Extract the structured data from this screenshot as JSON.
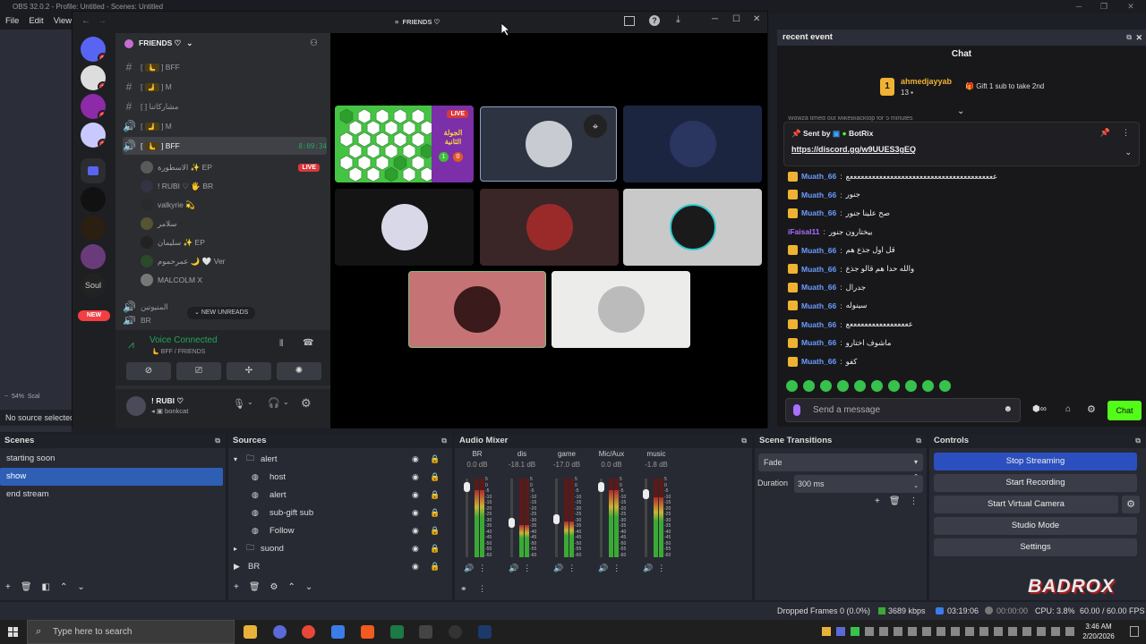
{
  "obs": {
    "title": "OBS 32.0.2 - Profile: Untitled - Scenes: Untitled",
    "menu": [
      "File",
      "Edit",
      "View"
    ],
    "zoom": "54%",
    "scale_label": "Scal",
    "no_source": "No source selected",
    "scenes": {
      "title": "Scenes",
      "items": [
        "starting soon",
        "show",
        "end stream"
      ],
      "selected": "show"
    },
    "sources": {
      "title": "Sources",
      "items": [
        {
          "name": "alert",
          "type": "folder",
          "indent": 0,
          "expanded": true
        },
        {
          "name": "host",
          "type": "browser",
          "indent": 1
        },
        {
          "name": "alert",
          "type": "browser",
          "indent": 1
        },
        {
          "name": "sub-gift sub",
          "type": "browser",
          "indent": 1
        },
        {
          "name": "Follow",
          "type": "browser",
          "indent": 1
        },
        {
          "name": "suond",
          "type": "folder",
          "indent": 0,
          "expanded": false
        },
        {
          "name": "BR",
          "type": "scene",
          "indent": 0,
          "expanded": false
        }
      ]
    },
    "mixer": {
      "title": "Audio Mixer",
      "channels": [
        {
          "name": "BR",
          "db": "0.0 dB",
          "level": 0.95
        },
        {
          "name": "dis",
          "db": "-18.1 dB",
          "level": 0.45
        },
        {
          "name": "game",
          "db": "-17.0 dB",
          "level": 0.5
        },
        {
          "name": "Mic/Aux",
          "db": "0.0 dB",
          "level": 0.95
        },
        {
          "name": "music",
          "db": "-1.8 dB",
          "level": 0.85
        }
      ],
      "scale": [
        "5",
        "0",
        "-5",
        "-10",
        "-15",
        "-20",
        "-25",
        "-30",
        "-35",
        "-40",
        "-45",
        "-50",
        "-55",
        "-60"
      ]
    },
    "transitions": {
      "title": "Scene Transitions",
      "selected": "Fade",
      "duration_label": "Duration",
      "duration": "300 ms"
    },
    "controls": {
      "title": "Controls",
      "buttons": [
        "Stop Streaming",
        "Start Recording",
        "Start Virtual Camera",
        "Studio Mode",
        "Settings"
      ]
    },
    "status": {
      "dropped": "Dropped Frames 0 (0.0%)",
      "kbps": "3689 kbps",
      "live_time": "03:19:06",
      "rec_time": "00:00:00",
      "cpu": "CPU: 3.8%",
      "fps": "60.00 / 60.00 FPS"
    }
  },
  "discord": {
    "title": "FRIENDS ♡",
    "server_name": "FRIENDS ♡",
    "channels": [
      {
        "icon": "#",
        "emoji": "🫷",
        "name": "BFF"
      },
      {
        "icon": "#",
        "emoji": "🫸",
        "name": "M"
      },
      {
        "icon": "#",
        "emoji": "",
        "name": "مشاركاتنا"
      },
      {
        "icon": "🔊",
        "emoji": "🫸",
        "name": "M"
      },
      {
        "icon": "🔊",
        "emoji": "🫷",
        "name": "BFF",
        "time": "8:09:34"
      }
    ],
    "voice_users": [
      {
        "name": "الاسطورة ✨ EP",
        "live": "LIVE"
      },
      {
        "name": "! RUBI ♡  🖐 BR"
      },
      {
        "name": "valkyrie 💫"
      },
      {
        "name": "سلامر"
      },
      {
        "name": "سليمان ✨ EP"
      },
      {
        "name": "عمرحموم 🌙 🤍 Ver"
      },
      {
        "name": "MALCOLM X"
      }
    ],
    "more_channels": [
      "المنيوتين",
      "BR"
    ],
    "new_unreads": "NEW UNREADS",
    "new_label": "NEW",
    "voice_connected": "Voice Connected",
    "voice_sub": "🫷 BFF / FRIENDS",
    "user_name": "! RUBI ♡",
    "user_status": "bonkcat",
    "tiles": [
      {
        "label": "LIVE",
        "kind": "game"
      },
      {
        "label": "",
        "kind": "avatar"
      },
      {
        "label": "",
        "kind": "avatar"
      },
      {
        "label": "",
        "kind": "avatar"
      },
      {
        "label": "",
        "kind": "avatar"
      },
      {
        "label": "",
        "kind": "avatar"
      },
      {
        "label": "",
        "kind": "avatar"
      },
      {
        "label": "",
        "kind": "avatar"
      }
    ],
    "game_title": "الجولة الثانية",
    "game_score": [
      "1",
      "0"
    ]
  },
  "botrix": {
    "panel_title": "recent event",
    "chat_title": "Chat",
    "top_user": "ahmedjayyab",
    "top_rank": "1",
    "top_count": "13",
    "top_event": "Gift 1 sub to take 2nd",
    "pinned_by": "Sent by",
    "pinned_bot": "BotRix",
    "pinned_link": "https://discord.gg/w9UUES3gEQ",
    "ticker": "Wowza timed out MikeBlacktop for 5 minutes",
    "messages": [
      {
        "user": "Muath_66",
        "text": "ععععععععععععععععععععععععععععععععععععععععع"
      },
      {
        "user": "Muath_66",
        "text": "جنور"
      },
      {
        "user": "Muath_66",
        "text": "صح علينا جنور"
      },
      {
        "user": "iFaisal11",
        "text": "بيختارون جنور"
      },
      {
        "user": "Muath_66",
        "text": "قل اول جذع هم"
      },
      {
        "user": "Muath_66",
        "text": "والله حدا هم قالو جذع"
      },
      {
        "user": "Muath_66",
        "text": "جدرال"
      },
      {
        "user": "Muath_66",
        "text": "سينوله"
      },
      {
        "user": "Muath_66",
        "text": "عععععععععععععععععع"
      },
      {
        "user": "Muath_66",
        "text": "ماشوف اختارو"
      },
      {
        "user": "Muath_66",
        "text": "كفو"
      }
    ],
    "input_placeholder": "Send a message",
    "chat_button": "Chat"
  },
  "watermark": "BADROX",
  "taskbar": {
    "search_placeholder": "Type here to search",
    "time": "3:46 AM",
    "date": "2/20/2026"
  }
}
